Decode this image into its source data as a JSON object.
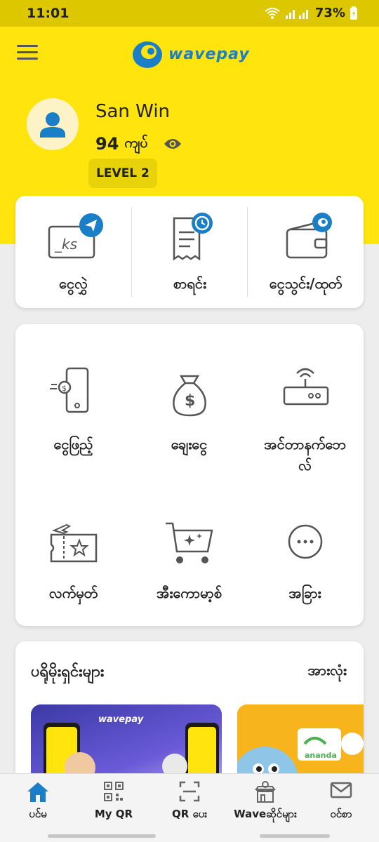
{
  "status_bar": {
    "time": "11:01",
    "battery": "73%"
  },
  "header": {
    "logo_text": "wavepay"
  },
  "profile": {
    "name": "San Win",
    "balance": "94",
    "currency": "ကျပ်",
    "level": "LEVEL 2"
  },
  "quick_actions": [
    {
      "label": "ငွေလွှဲ",
      "icon": "money-transfer-icon"
    },
    {
      "label": "စာရင်း",
      "icon": "history-receipt-icon"
    },
    {
      "label": "ငွေသွင်း/ထုတ်",
      "icon": "wallet-icon"
    }
  ],
  "services": [
    {
      "label": "ငွေဖြည့်",
      "icon": "phone-topup-icon"
    },
    {
      "label": "ချေးငွေ",
      "icon": "money-bag-icon"
    },
    {
      "label": "အင်တာနက်ဘေ",
      "label2": "လ်",
      "icon": "router-icon"
    },
    {
      "label": "လက်မှတ်",
      "icon": "ticket-icon"
    },
    {
      "label": "အီးကောမာ့စ်",
      "icon": "cart-icon"
    },
    {
      "label": "အခြား",
      "icon": "more-icon"
    }
  ],
  "promotions": {
    "title": "ပရိုမိုးရှင်းများ",
    "see_all": "အားလုံး",
    "banner1_brand": "wavepay",
    "banner2_brand": "ananda"
  },
  "bottom_nav": [
    {
      "label": "ပင်မ",
      "icon": "home-icon",
      "active": true
    },
    {
      "label": "My QR",
      "icon": "qr-code-icon"
    },
    {
      "label": "QR ပေး",
      "icon": "scan-icon"
    },
    {
      "label": "Waveဆိုင်များ",
      "icon": "shop-icon"
    },
    {
      "label": "ဝင်စာ",
      "icon": "mail-icon"
    }
  ],
  "colors": {
    "brand_yellow": "#ffe50d",
    "brand_blue": "#1a7fc6",
    "icon_gray": "#555555"
  }
}
